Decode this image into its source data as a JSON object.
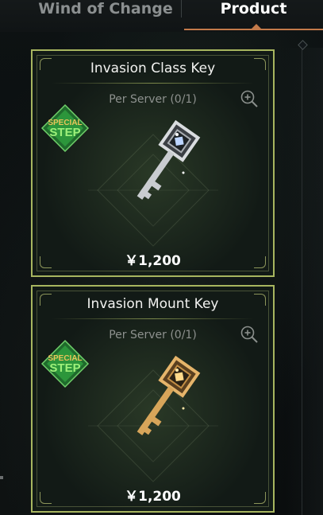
{
  "tabs": [
    {
      "label": "Wind of Change",
      "active": false
    },
    {
      "label": "Product",
      "active": true
    }
  ],
  "colors": {
    "active_tab_accent": "#c37a4a",
    "card_border": "#a7b55f",
    "badge_green": "#2f9e3e",
    "badge_text_gold": "#e9c45a",
    "silver_key": "#c9ccd0",
    "gold_key": "#d7a55a"
  },
  "products": [
    {
      "name": "Invasion Class Key",
      "limit": "Per Server (0/1)",
      "price": "￥1,200",
      "badge_top": "SPECIAL",
      "badge_bottom": "STEP",
      "icon": "silver-key-icon"
    },
    {
      "name": "Invasion Mount Key",
      "limit": "Per Server (0/1)",
      "price": "￥1,200",
      "badge_top": "SPECIAL",
      "badge_bottom": "STEP",
      "icon": "gold-key-icon"
    }
  ]
}
